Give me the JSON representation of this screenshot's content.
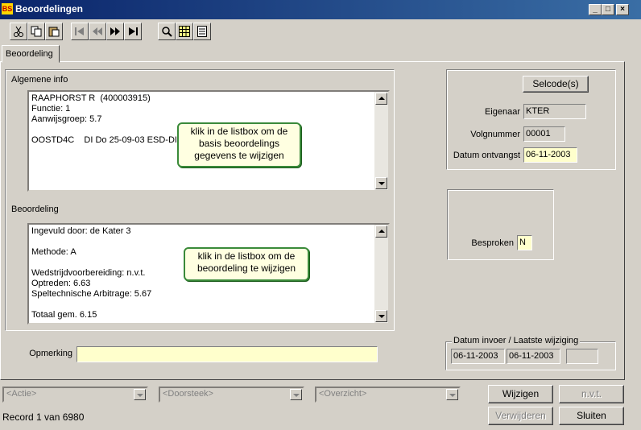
{
  "window": {
    "title": "Beoordelingen",
    "app_icon_label": "BS",
    "controls": [
      "_",
      "□",
      "×"
    ]
  },
  "toolbar": {
    "icons": [
      "cut-icon",
      "copy-icon",
      "paste-icon",
      "first-record-icon",
      "previous-record-icon",
      "next-record-icon",
      "last-record-icon",
      "search-icon",
      "grid-view-icon",
      "form-view-icon"
    ]
  },
  "tabs": [
    {
      "label": "Beoordeling",
      "active": true
    }
  ],
  "algemene_info": {
    "label": "Algemene info",
    "lines": [
      "RAAPHORST R  (400003915)",
      "Functie: 1",
      "Aanwijsgroep: 5.7",
      "",
      "OOSTD4C    DI Do 25-09-03 ESD-DI"
    ],
    "tooltip": [
      "klik in de listbox om de",
      "basis beoordelings",
      "gegevens te wijzigen"
    ]
  },
  "beoordeling": {
    "label": "Beoordeling",
    "lines": [
      "Ingevuld door: de Kater 3",
      "",
      "Methode: A",
      "",
      "Wedstrijdvoorbereiding: n.v.t.",
      "Optreden: 6.63",
      "Speltechnische Arbitrage: 5.67",
      "",
      "Totaal gem. 6.15"
    ],
    "tooltip": [
      "klik in de listbox om de",
      "beoordeling te wijzigen"
    ]
  },
  "opmerking": {
    "label": "Opmerking",
    "value": ""
  },
  "right_panel": {
    "selcode_button": "Selcode(s)",
    "eigenaar": {
      "label": "Eigenaar",
      "value": "KTER"
    },
    "volgnummer": {
      "label": "Volgnummer",
      "value": "00001"
    },
    "datum_ontvangst": {
      "label": "Datum ontvangst",
      "value": "06-11-2003"
    },
    "besproken": {
      "label": "Besproken",
      "value": "N"
    }
  },
  "datum_invoer": {
    "label": "Datum invoer / Laatste wijziging",
    "invoer": "06-11-2003",
    "laatste": "06-11-2003",
    "extra": ""
  },
  "bottom": {
    "actie": "<Actie>",
    "doorsteek": "<Doorsteek>",
    "overzicht": "<Overzicht>",
    "wijzigen": "Wijzigen",
    "nvt": "n.v.t.",
    "verwijderen": "Verwijderen",
    "sluiten": "Sluiten",
    "record_status": "Record 1 van 6980"
  },
  "colors": {
    "title_bar": "#0a246a",
    "tooltip_border": "#3a8a3a",
    "tooltip_bg": "#ffffe1",
    "field_highlight": "#ffffcc"
  }
}
